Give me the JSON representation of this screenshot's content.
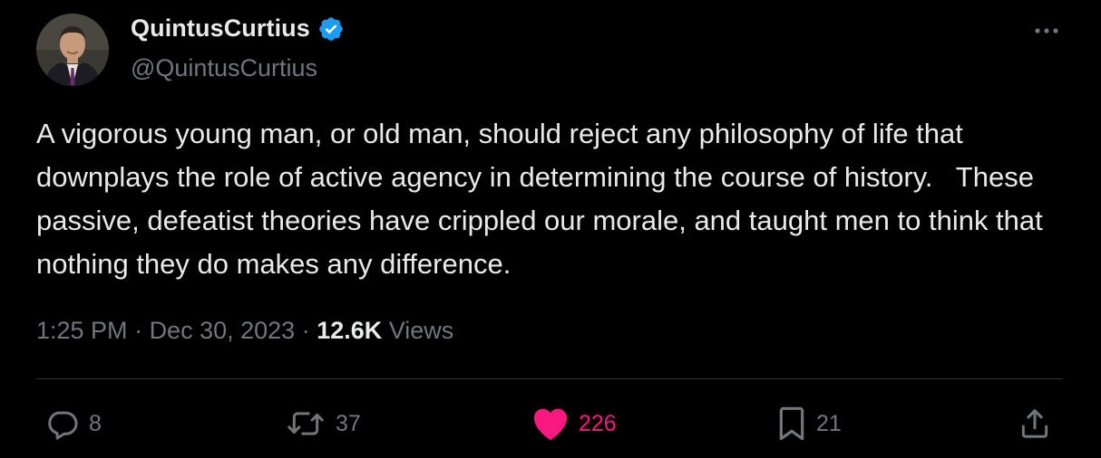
{
  "author": {
    "display_name": "QuintusCurtius",
    "handle": "@QuintusCurtius",
    "verified": true,
    "verified_icon": "verified-badge-icon"
  },
  "tweet": {
    "text": "A vigorous young man, or old man, should reject any philosophy of life that downplays the role of active agency in determining the course of history.   These passive, defeatist theories have crippled our morale, and taught men to think that nothing they do makes any difference."
  },
  "meta": {
    "time": "1:25 PM",
    "separator": " · ",
    "date": "Dec 30, 2023",
    "views_count": "12.6K",
    "views_label": " Views"
  },
  "actions": {
    "reply": {
      "icon": "reply-icon",
      "count": "8"
    },
    "retweet": {
      "icon": "retweet-icon",
      "count": "37"
    },
    "like": {
      "icon": "heart-icon",
      "count": "226",
      "liked": true
    },
    "bookmark": {
      "icon": "bookmark-icon",
      "count": "21"
    },
    "share": {
      "icon": "share-icon"
    }
  },
  "colors": {
    "background": "#000000",
    "text_primary": "#e7e9ea",
    "text_secondary": "#71767b",
    "verified_blue": "#1d9bf0",
    "like_pink": "#f91880",
    "divider": "#2f3336"
  }
}
